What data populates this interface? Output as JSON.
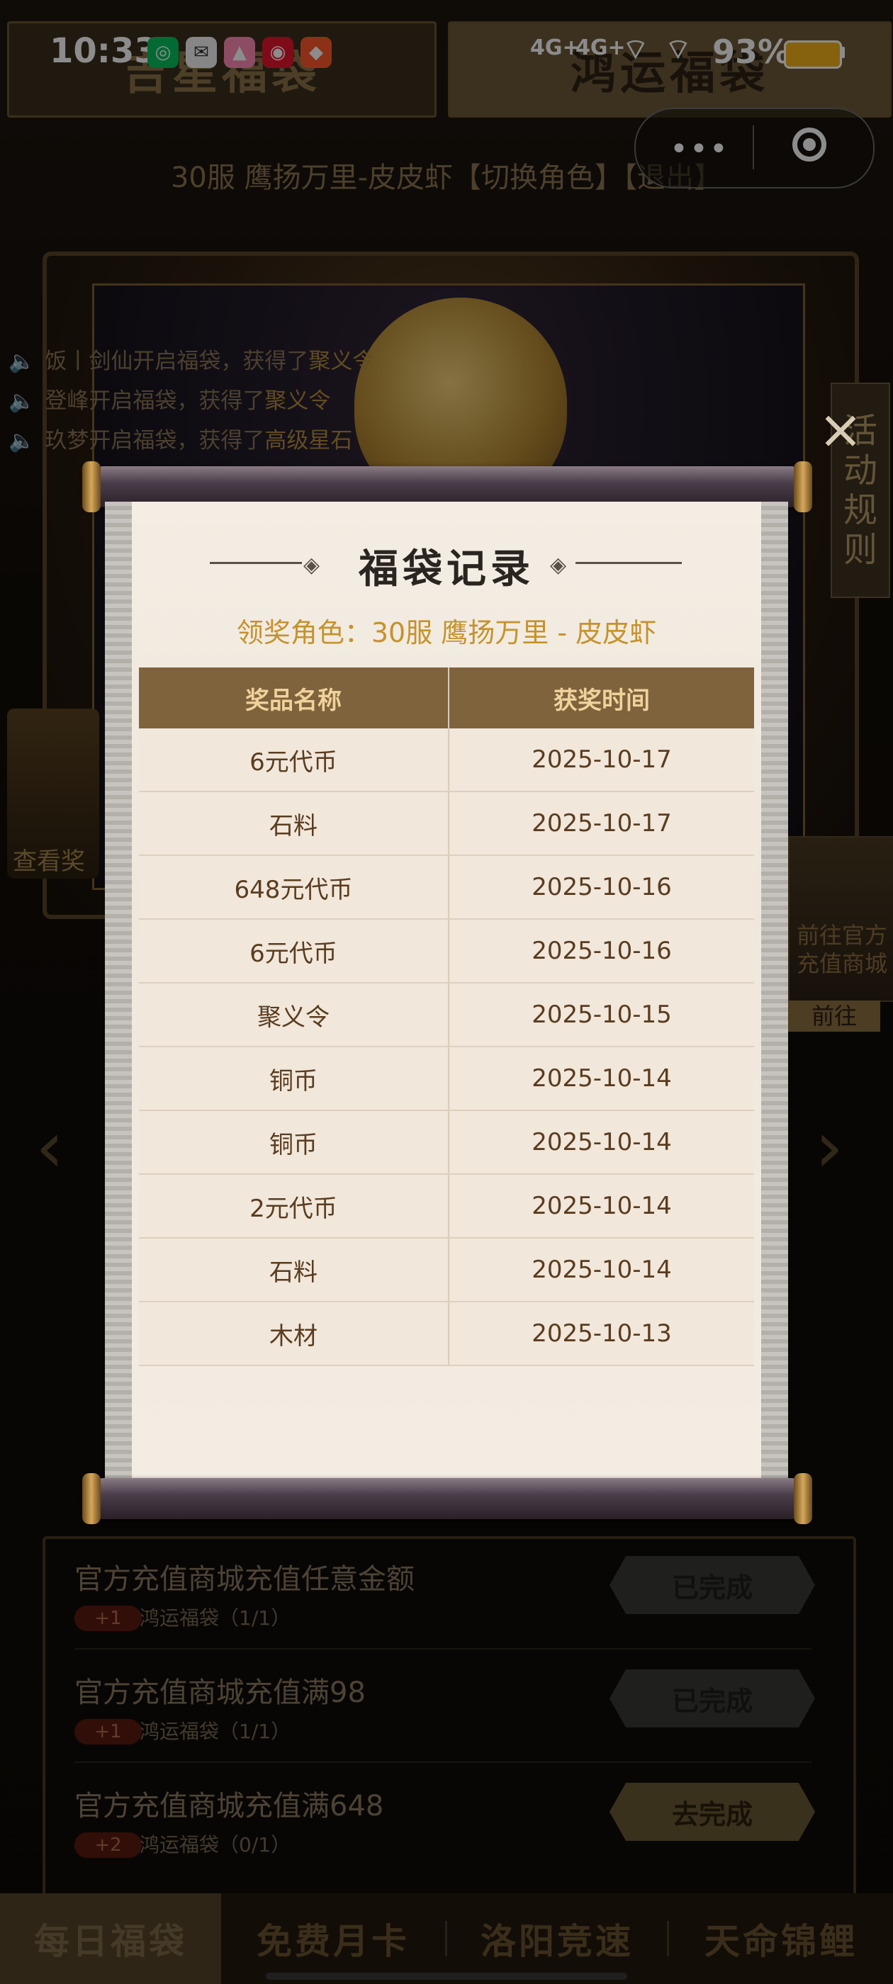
{
  "status_bar": {
    "time": "10:33",
    "signal1": "4G+",
    "signal2": "4G+",
    "battery": "93%",
    "app_icons": [
      "wechat-icon",
      "mail-icon",
      "wallet-icon",
      "weibo-icon",
      "game-icon"
    ]
  },
  "capsule": {
    "more_label": "•••"
  },
  "page": {
    "tab_left": "吉星福袋",
    "tab_right": "鸿运福袋",
    "role_line": "30服 鹰扬万里-皮皮虾【切换角色】【退出】",
    "side_tab": [
      "活",
      "动",
      "规",
      "则"
    ],
    "left_card_label": "查看奖",
    "right_card_text": "前往官方充值商城",
    "right_card_button": "前往"
  },
  "ticker": [
    {
      "prefix": "饭丨剑仙开启福袋，获得了",
      "item": "聚义令"
    },
    {
      "prefix": "登峰开启福袋，获得了",
      "item": "聚义令"
    },
    {
      "prefix": "玖梦开启福袋，获得了",
      "item": "高级星石"
    }
  ],
  "modal": {
    "title": "福袋记录",
    "winner_role": "领奖角色：30服 鹰扬万里 - 皮皮虾",
    "columns": [
      "奖品名称",
      "获奖时间"
    ],
    "rows": [
      {
        "prize": "6元代币",
        "date": "2025-10-17"
      },
      {
        "prize": "石料",
        "date": "2025-10-17"
      },
      {
        "prize": "648元代币",
        "date": "2025-10-16"
      },
      {
        "prize": "6元代币",
        "date": "2025-10-16"
      },
      {
        "prize": "聚义令",
        "date": "2025-10-15"
      },
      {
        "prize": "铜币",
        "date": "2025-10-14"
      },
      {
        "prize": "铜币",
        "date": "2025-10-14"
      },
      {
        "prize": "2元代币",
        "date": "2025-10-14"
      },
      {
        "prize": "石料",
        "date": "2025-10-14"
      },
      {
        "prize": "木材",
        "date": "2025-10-13"
      }
    ]
  },
  "tasks": [
    {
      "title": "官方充值商城充值任意金额",
      "badge": "+1",
      "sub": "鸿运福袋（1/1）",
      "button": "已完成",
      "state": "done"
    },
    {
      "title": "官方充值商城充值满98",
      "badge": "+1",
      "sub": "鸿运福袋（1/1）",
      "button": "已完成",
      "state": "done"
    },
    {
      "title": "官方充值商城充值满648",
      "badge": "+2",
      "sub": "鸿运福袋（0/1）",
      "button": "去完成",
      "state": "todo"
    }
  ],
  "bottom_nav": [
    "每日福袋",
    "免费月卡",
    "洛阳竞速",
    "天命锦鲤"
  ]
}
